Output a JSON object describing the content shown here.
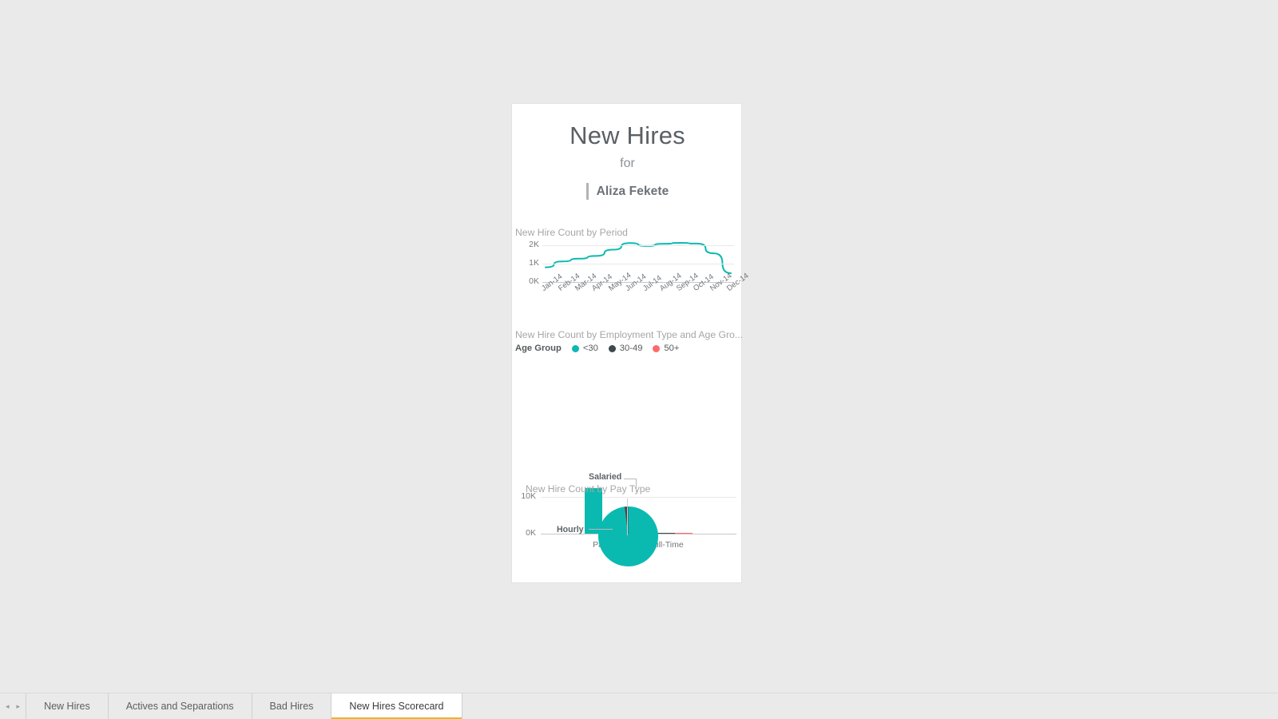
{
  "report": {
    "title": "New Hires",
    "for_label": "for",
    "person_name": "Aliza Fekete"
  },
  "colors": {
    "accent_teal": "#0ABAB0",
    "dark": "#3C4A4E",
    "red": "#FC6A6A",
    "page_background": "#EAEAEA",
    "card_background": "#FFFFFF",
    "tab_active_underline": "#E8B923"
  },
  "tabbar": {
    "prev_arrow": "◂",
    "next_arrow": "▸",
    "tabs": [
      {
        "label": "New Hires",
        "active": false
      },
      {
        "label": "Actives and Separations",
        "active": false
      },
      {
        "label": "Bad Hires",
        "active": false
      },
      {
        "label": "New Hires Scorecard",
        "active": true
      }
    ]
  },
  "chart_data": [
    {
      "type": "line",
      "title": "New Hire Count by Period",
      "xlabel": "",
      "ylabel": "",
      "ylim": [
        0,
        2500
      ],
      "yticks": [
        0,
        1000,
        2000
      ],
      "ytick_labels": [
        "0K",
        "1K",
        "2K"
      ],
      "grid": true,
      "legend": "none",
      "series_color": "#0ABAB0",
      "categories": [
        "Jan-14",
        "Feb-14",
        "Mar-14",
        "Apr-14",
        "May-14",
        "Jun-14",
        "Jul-14",
        "Aug-14",
        "Sep-14",
        "Oct-14",
        "Nov-14",
        "Dec-14"
      ],
      "values": [
        800,
        1120,
        1270,
        1420,
        1760,
        2120,
        1960,
        2080,
        2130,
        2090,
        1560,
        480
      ]
    },
    {
      "type": "bar",
      "title": "New Hire Count by Employment Type and Age Gro...",
      "legend_caption": "Age Group",
      "legend_position": "top",
      "xlabel": "",
      "ylabel": "",
      "ylim": [
        0,
        14000
      ],
      "yticks": [
        0,
        10000
      ],
      "ytick_labels": [
        "0K",
        "10K"
      ],
      "grid": true,
      "categories": [
        "Part-Time",
        "Full-Time"
      ],
      "series": [
        {
          "name": "<30",
          "color": "#0ABAB0",
          "values": [
            12500,
            520
          ]
        },
        {
          "name": "30-49",
          "color": "#3C4A4E",
          "values": [
            2600,
            320
          ]
        },
        {
          "name": "50+",
          "color": "#FC6A6A",
          "values": [
            1800,
            160
          ]
        }
      ]
    },
    {
      "type": "pie",
      "title": "New Hire Count by Pay Type",
      "labels": [
        "Hourly",
        "Salaried"
      ],
      "values": [
        98,
        2
      ],
      "colors": [
        "#0ABAB0",
        "#3C4A4E"
      ],
      "legend": "labels-with-leader-lines"
    }
  ]
}
